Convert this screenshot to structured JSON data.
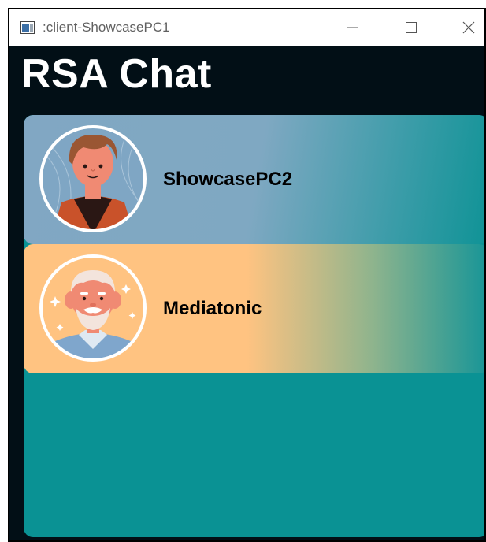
{
  "window": {
    "title": ":client-ShowcasePC1",
    "controls": [
      "minimize-icon",
      "maximize-icon",
      "close-icon"
    ]
  },
  "app": {
    "title": "RSA Chat"
  },
  "contacts": [
    {
      "name": "ShowcasePC2",
      "avatar": "young-man-avatar-icon"
    },
    {
      "name": "Mediatonic",
      "avatar": "old-man-avatar-icon"
    }
  ],
  "colors": {
    "background": "#020f16",
    "panel": "#0a9294",
    "contact1": "#81a7c3",
    "contact2": "#ffc381",
    "title_text": "#ffffff"
  }
}
